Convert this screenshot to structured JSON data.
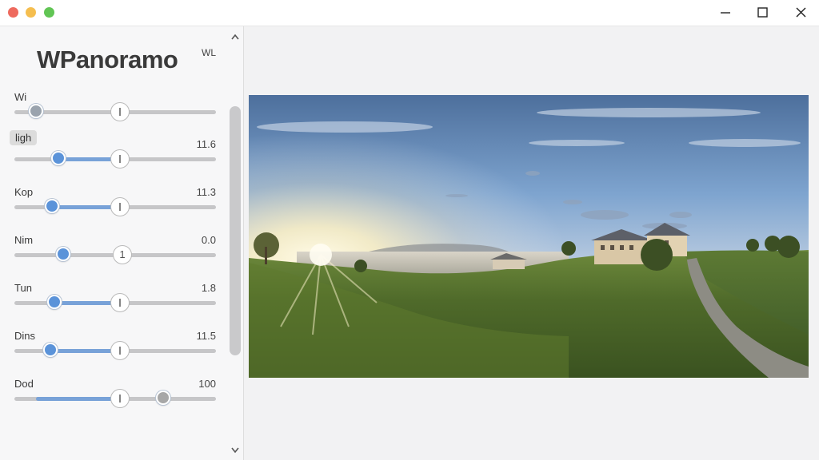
{
  "window": {
    "controls": [
      "close",
      "minimize",
      "zoom"
    ],
    "actions": [
      "minimize-icon",
      "maximize-icon",
      "close-icon"
    ]
  },
  "sidebar": {
    "title": "WPanoramo",
    "badge": "WL",
    "sliders": [
      {
        "label": "Wi",
        "value": "",
        "level": 0.11,
        "knob_text": "",
        "handle_color": "#9aa3ad"
      },
      {
        "label": "ligh",
        "value": "11.6",
        "level": 0.22,
        "knob_text": "",
        "handle_color": "#5b93d9",
        "label_highlighted": true
      },
      {
        "label": "Kop",
        "value": "11.3",
        "level": 0.19,
        "knob_text": "",
        "handle_color": "#5b93d9"
      },
      {
        "label": "Nim",
        "value": "0.0",
        "level": 0.24,
        "knob_text": "1",
        "handle_color": "#5b93d9"
      },
      {
        "label": "Tun",
        "value": "1.8",
        "level": 0.2,
        "knob_text": "",
        "handle_color": "#5b93d9"
      },
      {
        "label": "Dins",
        "value": "11.5",
        "level": 0.18,
        "knob_text": "",
        "handle_color": "#5b93d9"
      },
      {
        "label": "Dod",
        "value": "100",
        "level": 0.74,
        "knob_text": "",
        "handle_color": "#a7a7a7"
      }
    ]
  },
  "main": {
    "image": "panorama-landscape (sunset over lake, houses on hill, path)"
  }
}
